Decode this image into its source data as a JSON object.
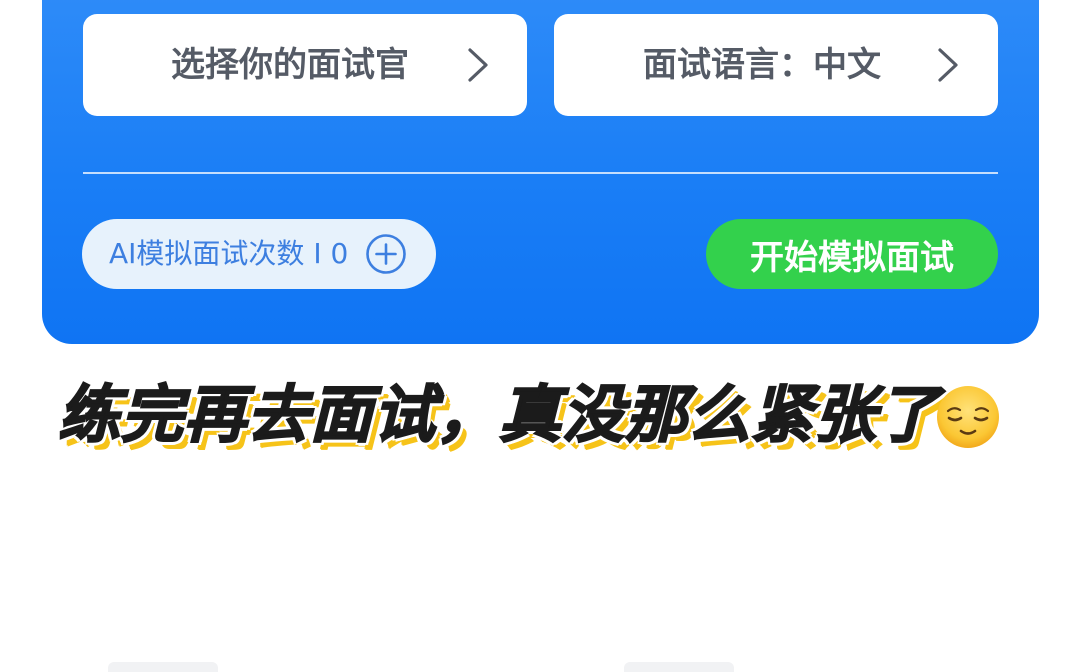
{
  "interviewer_card": {
    "label": "选择你的面试官"
  },
  "language_card": {
    "label": "面试语言：中文"
  },
  "counter": {
    "label": "AI模拟面试次数 I 0"
  },
  "start_button": {
    "label": "开始模拟面试"
  },
  "caption": {
    "text": "练完再去面试，真没那么紧张了"
  },
  "colors": {
    "panel_blue": "#1a7ef6",
    "start_green": "#33d14c",
    "counter_text": "#3d7fe0",
    "caption_shadow": "#f6c319"
  },
  "icons": [
    "chevron-right-icon",
    "plus-circle-icon",
    "relieved-face-emoji"
  ]
}
